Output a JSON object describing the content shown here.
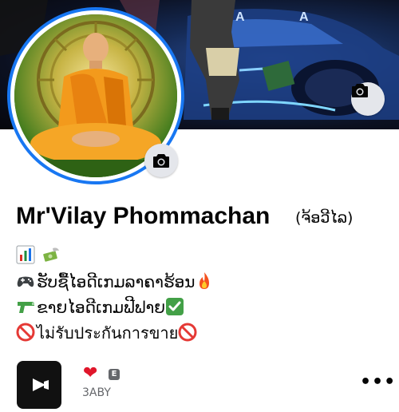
{
  "profile": {
    "name": "Mr'Vilay Phommachan",
    "alternate_name": "(ຈ້ອວີໄລ)"
  },
  "bio": {
    "line1_icons": [
      "bar-chart-icon",
      "money-with-wings-icon"
    ],
    "line2": "ຮັບຊື້ໄອດີເກມລາຄາຮ້ອນ",
    "line2_icons": [
      "game-controller-icon",
      "fire-icon"
    ],
    "line3": "ຂາຍໄອດີເກມຟີຟາຍ",
    "line3_icons": [
      "water-pistol-icon",
      "check-mark-button-icon"
    ],
    "line4": "ไม่รับประกันการขาย",
    "line4_icons": [
      "prohibited-icon",
      "prohibited-icon"
    ]
  },
  "featured": {
    "heart": "❤",
    "badge": "E",
    "code": "3ABY"
  },
  "more_label": "•••",
  "colors": {
    "accent": "#1877f2",
    "text": "#050505",
    "secondary_text": "#65676b",
    "button_bg": "#e4e6eb"
  }
}
